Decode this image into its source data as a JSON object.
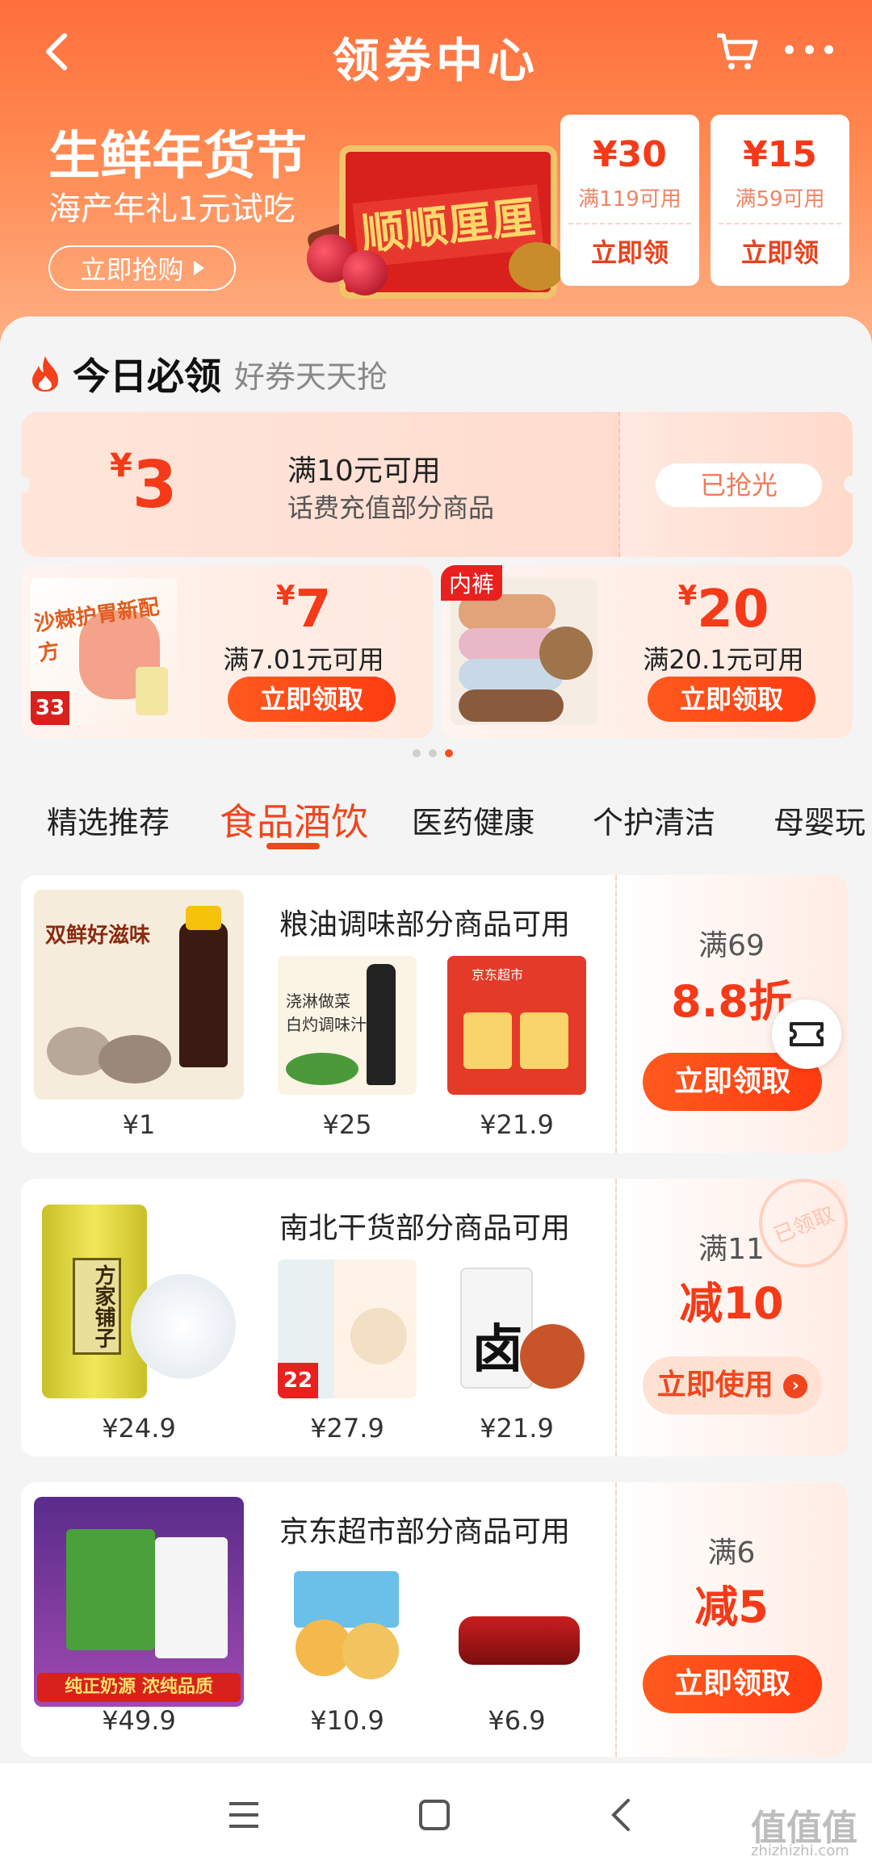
{
  "header": {
    "title": "领券中心"
  },
  "banner": {
    "title": "生鲜年货节",
    "subtitle": "海产年礼1元试吃",
    "button": "立即抢购",
    "gift_text": "顺顺厘厘"
  },
  "top_coupons": [
    {
      "amount": "¥30",
      "condition": "满119可用",
      "button": "立即领"
    },
    {
      "amount": "¥15",
      "condition": "满59可用",
      "button": "立即领"
    }
  ],
  "today": {
    "title": "今日必领",
    "subtitle": "好券天天抢"
  },
  "phone_coupon": {
    "currency": "¥",
    "amount": "3",
    "condition": "满10元可用",
    "description": "话费充值部分商品",
    "button": "已抢光"
  },
  "product_coupons": [
    {
      "currency": "¥",
      "amount": "7",
      "condition": "满7.01元可用",
      "button": "立即领取",
      "tag": "",
      "img_text": "沙棘护胃新配方",
      "img_price": "33"
    },
    {
      "currency": "¥",
      "amount": "20",
      "condition": "满20.1元可用",
      "button": "立即领取",
      "tag": "内裤",
      "img_text": "",
      "img_price": ""
    }
  ],
  "carousel": {
    "count": 3,
    "active": 2
  },
  "tabs": [
    "精选推荐",
    "食品酒饮",
    "医药健康",
    "个护清洁",
    "母婴玩"
  ],
  "active_tab": 1,
  "coupons": [
    {
      "title": "粮油调味部分商品可用",
      "threshold": "满69",
      "discount": "8.8折",
      "button": "立即领取",
      "button_type": "get",
      "prices": [
        "¥1",
        "¥25",
        "¥21.9"
      ],
      "img_texts": [
        "双鲜好滋味",
        "浇淋做菜 白灼调味汁",
        "京东超市"
      ]
    },
    {
      "title": "南北干货部分商品可用",
      "threshold": "满11",
      "discount": "减10",
      "button": "立即使用",
      "button_type": "use",
      "prices": [
        "¥24.9",
        "¥27.9",
        "¥21.9"
      ],
      "img_texts": [
        "方家铺子",
        "22",
        "卤"
      ],
      "stamp": "已领取"
    },
    {
      "title": "京东超市部分商品可用",
      "threshold": "满6",
      "discount": "减5",
      "button": "立即领取",
      "button_type": "get",
      "prices": [
        "¥49.9",
        "¥10.9",
        "¥6.9"
      ],
      "img_texts": [
        "纯正奶源 浓纯品质",
        "",
        ""
      ]
    }
  ],
  "watermark": {
    "main": "值值值",
    "sub": "zhizhizhi.com"
  },
  "colors": {
    "accent": "#f43a18",
    "header_bg": "#ff7a45",
    "button": "#ff4a18"
  }
}
